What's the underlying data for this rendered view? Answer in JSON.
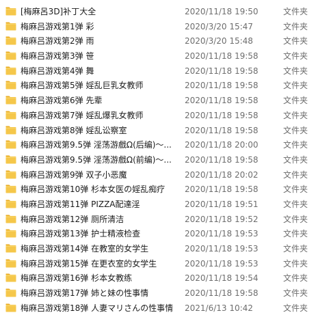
{
  "folder_icon": "folder-icon",
  "colors": {
    "folder_body": "#f5c74a",
    "folder_tab": "#e9ae2a",
    "name_text": "#1a1a1a",
    "meta_text": "#6d6d6d"
  },
  "files": [
    {
      "name": "[梅麻呂3D]补丁大全",
      "date": "2020/11/18 19:50",
      "type": "文件夹"
    },
    {
      "name": "梅麻吕游戏第1弹 彩",
      "date": "2020/3/20 15:47",
      "type": "文件夹"
    },
    {
      "name": "梅麻吕游戏第2弹 雨",
      "date": "2020/3/20 15:48",
      "type": "文件夹"
    },
    {
      "name": "梅麻吕游戏第3弹 笹",
      "date": "2020/11/18 19:58",
      "type": "文件夹"
    },
    {
      "name": "梅麻吕游戏第4弹 舞",
      "date": "2020/11/18 19:58",
      "type": "文件夹"
    },
    {
      "name": "梅麻吕游戏第5弹 婬乱巨乳女教师",
      "date": "2020/11/18 19:58",
      "type": "文件夹"
    },
    {
      "name": "梅麻吕游戏第6弹 先辈",
      "date": "2020/11/18 19:58",
      "type": "文件夹"
    },
    {
      "name": "梅麻吕游戏第7弹 婬乱爆乳女教师",
      "date": "2020/11/18 19:58",
      "type": "文件夹"
    },
    {
      "name": "梅麻吕游戏第8弹 婬乱讼察室",
      "date": "2020/11/18 19:58",
      "type": "文件夹"
    },
    {
      "name": "梅麻吕游戏第9.5弹 淫荡游戲Ω(后编)～...",
      "date": "2020/11/18 20:00",
      "type": "文件夹"
    },
    {
      "name": "梅麻吕游戏第9.5弹 淫荡游戲Ω(前编)～...",
      "date": "2020/11/18 19:58",
      "type": "文件夹"
    },
    {
      "name": "梅麻吕游戏第9弹 双子小恶魔",
      "date": "2020/11/18 20:02",
      "type": "文件夹"
    },
    {
      "name": "梅麻吕游戏第10弹 杉本女医の婬乱痴疗",
      "date": "2020/11/18 19:58",
      "type": "文件夹"
    },
    {
      "name": "梅麻吕游戏第11弹 PIZZA配達淫",
      "date": "2020/11/18 19:51",
      "type": "文件夹"
    },
    {
      "name": "梅麻吕游戏第12弹 厕所清洁",
      "date": "2020/11/18 19:52",
      "type": "文件夹"
    },
    {
      "name": "梅麻吕游戏第13弹 护士精液检查",
      "date": "2020/11/18 19:53",
      "type": "文件夹"
    },
    {
      "name": "梅麻吕游戏第14弹 在教室的女学生",
      "date": "2020/11/18 19:53",
      "type": "文件夹"
    },
    {
      "name": "梅麻吕游戏第15弹 在更衣室的女学生",
      "date": "2020/11/18 19:53",
      "type": "文件夹"
    },
    {
      "name": "梅麻吕游戏第16弹 杉本女教练",
      "date": "2020/11/18 19:54",
      "type": "文件夹"
    },
    {
      "name": "梅麻吕游戏第17弹 姉と妹の性事情",
      "date": "2020/11/18 19:58",
      "type": "文件夹"
    },
    {
      "name": "梅麻吕游戏第18弹 人妻マリさんの性事情",
      "date": "2021/6/13 10:42",
      "type": "文件夹"
    }
  ]
}
